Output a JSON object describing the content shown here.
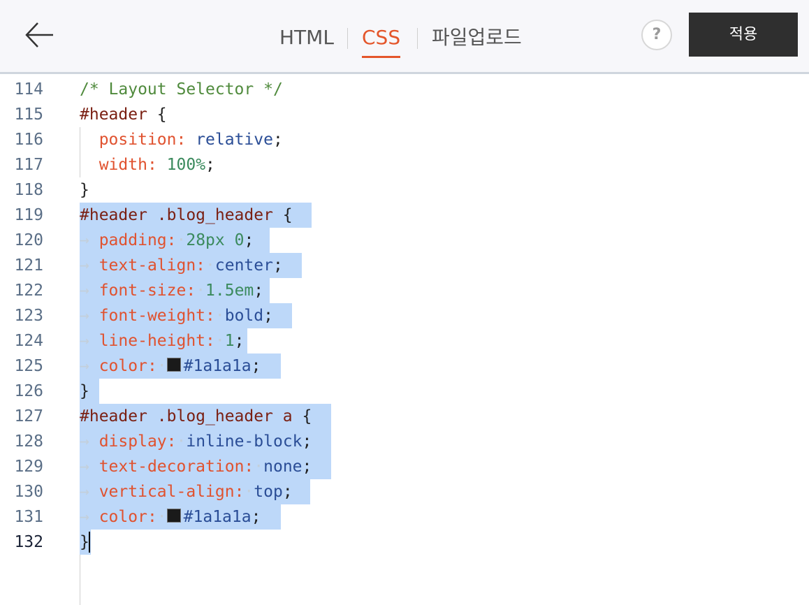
{
  "header": {
    "tabs": [
      {
        "label": "HTML",
        "active": false
      },
      {
        "label": "CSS",
        "active": true
      },
      {
        "label": "파일업로드",
        "active": false
      }
    ],
    "help_label": "?",
    "apply_label": "적용"
  },
  "colors": {
    "accent": "#e4562b",
    "apply_bg": "#2f2f2f",
    "selection": "#bdd8f9",
    "comment": "#4f8a3c",
    "selector": "#7a1f12",
    "property": "#e0522f",
    "keyword": "#2a4d96",
    "number": "#3b8a5d",
    "swatch": "#1a1a1a"
  },
  "editor": {
    "current_line": "132",
    "lines": [
      {
        "no": "114",
        "comment": "/* Layout Selector */"
      },
      {
        "no": "115",
        "selector": "#header",
        "brace": " {"
      },
      {
        "no": "116",
        "prop": "position:",
        "value": "relative",
        "semi": ";"
      },
      {
        "no": "117",
        "prop": "width:",
        "value": "100%",
        "semi": ";"
      },
      {
        "no": "118",
        "brace": "}"
      },
      {
        "no": "119",
        "selector": "#header .blog_header",
        "brace": " {"
      },
      {
        "no": "120",
        "prop": "padding:",
        "value": "28px 0",
        "semi": ";"
      },
      {
        "no": "121",
        "prop": "text-align:",
        "value": "center",
        "semi": ";"
      },
      {
        "no": "122",
        "prop": "font-size:",
        "value": "1.5em",
        "semi": ";"
      },
      {
        "no": "123",
        "prop": "font-weight:",
        "value": "bold",
        "semi": ";"
      },
      {
        "no": "124",
        "prop": "line-height:",
        "value": "1",
        "semi": ";"
      },
      {
        "no": "125",
        "prop": "color:",
        "value": "#1a1a1a",
        "semi": ";"
      },
      {
        "no": "126",
        "brace": "}"
      },
      {
        "no": "127",
        "selector": "#header .blog_header a",
        "brace": " {"
      },
      {
        "no": "128",
        "prop": "display:",
        "value": "inline-block",
        "semi": ";"
      },
      {
        "no": "129",
        "prop": "text-decoration:",
        "value": "none",
        "semi": ";"
      },
      {
        "no": "130",
        "prop": "vertical-align:",
        "value": "top",
        "semi": ";"
      },
      {
        "no": "131",
        "prop": "color:",
        "value": "#1a1a1a",
        "semi": ";"
      },
      {
        "no": "132",
        "brace": "}"
      }
    ]
  }
}
